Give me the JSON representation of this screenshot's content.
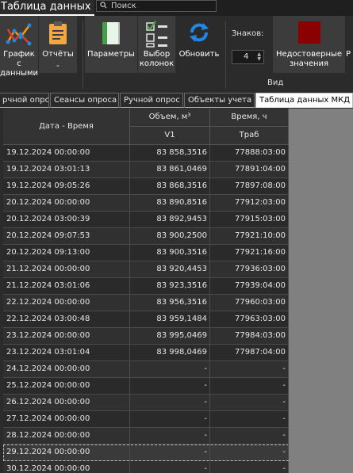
{
  "app": {
    "title": "Таблица данных"
  },
  "search": {
    "placeholder": "Поиск"
  },
  "ribbon": {
    "buttons": [
      {
        "label": "График с\nданными"
      },
      {
        "label": "Отчёты"
      },
      {
        "label": "Параметры"
      },
      {
        "label": "Выбор\nколонок"
      },
      {
        "label": "Обновить"
      },
      {
        "label": "Недостоверные\nзначения"
      },
      {
        "label": "Р"
      }
    ],
    "digits_label": "Знаков:",
    "digits_value": "4",
    "group_label": "Вид"
  },
  "tabs": [
    {
      "label": "рчной опрос"
    },
    {
      "label": "Сеансы опроса"
    },
    {
      "label": "Ручной опрос"
    },
    {
      "label": "Объекты учета"
    },
    {
      "label": "Таблица данных МКД Н"
    }
  ],
  "table": {
    "headers": {
      "datetime": "Дата - Время",
      "volume": "Объем, м³",
      "volume_sub": "V1",
      "time": "Время, ч",
      "time_sub": "Траб"
    },
    "rows": [
      [
        "19.12.2024 00:00:00",
        "83 858,3516",
        "77888:03:00"
      ],
      [
        "19.12.2024 03:01:13",
        "83 861,0469",
        "77891:04:00"
      ],
      [
        "19.12.2024 09:05:26",
        "83 868,3516",
        "77897:08:00"
      ],
      [
        "20.12.2024 00:00:00",
        "83 890,8516",
        "77912:03:00"
      ],
      [
        "20.12.2024 03:00:39",
        "83 892,9453",
        "77915:03:00"
      ],
      [
        "20.12.2024 09:07:53",
        "83 900,2500",
        "77921:10:00"
      ],
      [
        "20.12.2024 09:13:00",
        "83 900,3516",
        "77921:16:00"
      ],
      [
        "21.12.2024 00:00:00",
        "83 920,4453",
        "77936:03:00"
      ],
      [
        "21.12.2024 03:01:06",
        "83 923,3516",
        "77939:04:00"
      ],
      [
        "22.12.2024 00:00:00",
        "83 956,3516",
        "77960:03:00"
      ],
      [
        "22.12.2024 03:00:48",
        "83 959,1484",
        "77963:03:00"
      ],
      [
        "23.12.2024 00:00:00",
        "83 995,0469",
        "77984:03:00"
      ],
      [
        "23.12.2024 03:01:04",
        "83 998,0469",
        "77987:04:00"
      ],
      [
        "24.12.2024 00:00:00",
        "-",
        "-"
      ],
      [
        "25.12.2024 00:00:00",
        "-",
        "-"
      ],
      [
        "26.12.2024 00:00:00",
        "-",
        "-"
      ],
      [
        "27.12.2024 00:00:00",
        "-",
        "-"
      ],
      [
        "28.12.2024 00:00:00",
        "-",
        "-"
      ],
      [
        "29.12.2024 00:00:00",
        "-",
        "-"
      ],
      [
        "30.12.2024 00:00:00",
        "-",
        "-"
      ]
    ],
    "selected_row": 18
  },
  "colors": {
    "accent_blue": "#1e88e5",
    "stop_red": "#8b0000",
    "check_green": "#4caf50",
    "chart_orange": "#ff9800",
    "clipboard_orange": "#f4a640"
  },
  "icons": [
    "search-icon",
    "chart-icon",
    "clipboard-icon",
    "book-icon",
    "checklist-icon",
    "refresh-icon",
    "stop-square-icon"
  ]
}
